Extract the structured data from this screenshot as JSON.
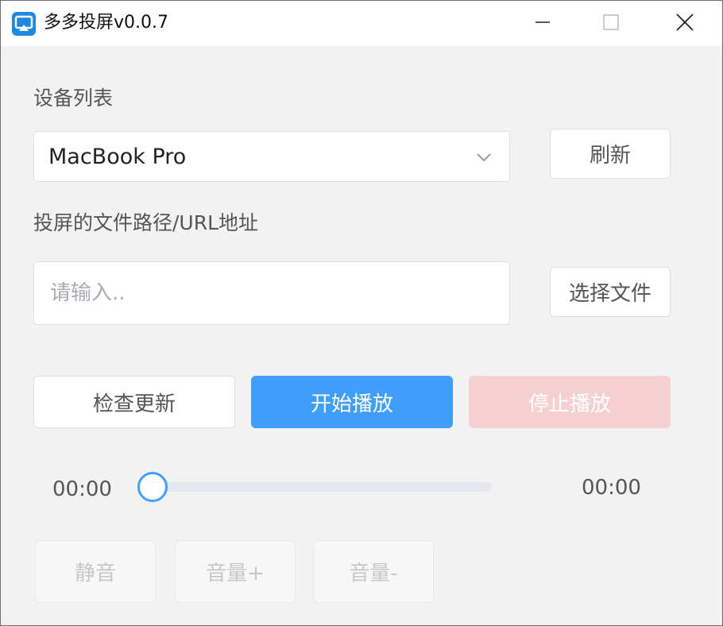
{
  "window": {
    "title": "多多投屏v0.0.7",
    "icon": "cast-screen-icon",
    "controls": {
      "minimize": "minimize-icon",
      "maximize": "maximize-icon",
      "close": "close-icon"
    }
  },
  "device": {
    "label": "设备列表",
    "selected": "MacBook Pro",
    "refresh_label": "刷新"
  },
  "file": {
    "label": "投屏的文件路径/URL地址",
    "placeholder": "请输入..",
    "value": "",
    "choose_label": "选择文件"
  },
  "actions": {
    "check_update": "检查更新",
    "start": "开始播放",
    "stop": "停止播放"
  },
  "playback": {
    "current_time": "00:00",
    "total_time": "00:00",
    "progress": 0
  },
  "volume": {
    "mute": "静音",
    "up": "音量+",
    "down": "音量-"
  },
  "colors": {
    "primary": "#409eff",
    "danger_disabled": "#f5d0d0",
    "border": "#dcdfe6",
    "background": "#f2f2f2"
  }
}
